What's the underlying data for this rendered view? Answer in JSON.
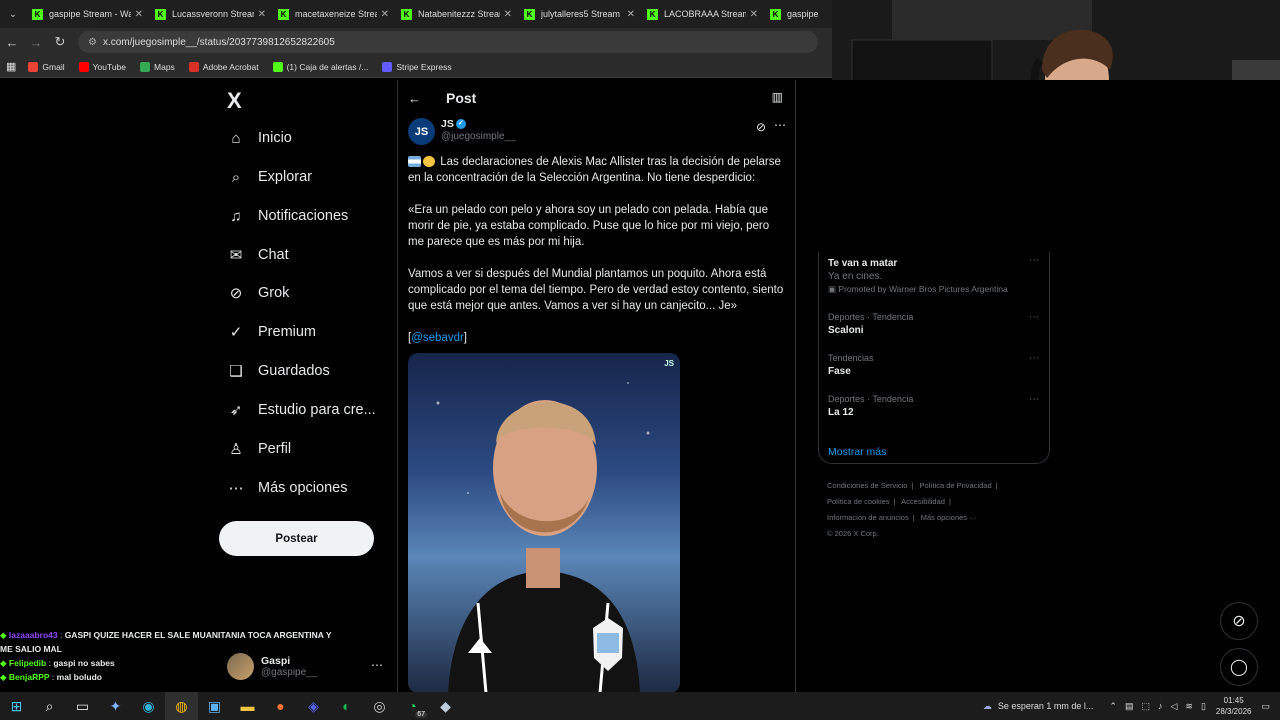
{
  "browser": {
    "tabs": [
      {
        "label": "gaspipe Stream - Wa"
      },
      {
        "label": "Lucassveronn Stream"
      },
      {
        "label": "macetaxeneize Strea"
      },
      {
        "label": "Natabenitezzz Stream"
      },
      {
        "label": "julytalleres5 Stream"
      },
      {
        "label": "LACOBRAAA Stream"
      },
      {
        "label": "gaspipe Strea"
      }
    ],
    "url": "x.com/juegosimple__/status/2037739812652822605",
    "bookmarks": [
      {
        "label": "Gmail",
        "color": "#ea4335"
      },
      {
        "label": "YouTube",
        "color": "#ff0000"
      },
      {
        "label": "Maps",
        "color": "#34a853"
      },
      {
        "label": "Adobe Acrobat",
        "color": "#d93025"
      },
      {
        "label": "(1) Caja de alertas /...",
        "color": "#53fc18"
      },
      {
        "label": "Stripe Express",
        "color": "#635bff"
      }
    ]
  },
  "nav": {
    "logo": "X",
    "items": [
      {
        "label": "Inicio",
        "icon": "⌂"
      },
      {
        "label": "Explorar",
        "icon": "⌕"
      },
      {
        "label": "Notificaciones",
        "icon": "♫"
      },
      {
        "label": "Chat",
        "icon": "✉"
      },
      {
        "label": "Grok",
        "icon": "⊘"
      },
      {
        "label": "Premium",
        "icon": "✓"
      },
      {
        "label": "Guardados",
        "icon": "❑"
      },
      {
        "label": "Estudio para cre...",
        "icon": "➶"
      },
      {
        "label": "Perfil",
        "icon": "♙"
      },
      {
        "label": "Más opciones",
        "icon": "⋯"
      }
    ],
    "post_button": "Postear",
    "account": {
      "name": "Gaspi",
      "handle": "@gaspipe__"
    }
  },
  "post": {
    "header_title": "Post",
    "author_initials": "JS",
    "author_name": "JS",
    "author_handle": "@juegosimple__",
    "paragraphs": [
      "Las declaraciones de Alexis Mac Allister tras la decisión de pelarse en la concentración de la Selección Argentina. No tiene desperdicio:",
      "«Era un pelado con pelo y ahora soy un pelado con pelada. Había que morir de pie, ya estaba complicado. Puse que lo hice por mi viejo, pero me parece que es más por mi hija.",
      "Vamos a ver si después del Mundial plantamos un poquito. Ahora está complicado por el tema del tiempo. Pero de verdad estoy contento, siento que está mejor que antes. Vamos a ver si hay un canjecito... Je»"
    ],
    "mention": "@sebavdr",
    "image_badge": "JS"
  },
  "trends": [
    {
      "meta": "",
      "title": "Te van a matar",
      "sub": "Ya en cines.",
      "promo": "Promoted by Warner Bros Pictures Argentina"
    },
    {
      "meta": "Deportes · Tendencia",
      "title": "Scaloni"
    },
    {
      "meta": "Tendencias",
      "title": "Fase"
    },
    {
      "meta": "Deportes · Tendencia",
      "title": "La 12"
    }
  ],
  "show_more": "Mostrar más",
  "footer": [
    "Condiciones de Servicio",
    "|",
    "Política de Privacidad",
    "|",
    "Política de cookies",
    "|",
    "Accesibilidad",
    "|",
    "Información de anuncios",
    "|",
    "Más opciones ···",
    "© 2026 X Corp."
  ],
  "chat": [
    {
      "user": "lazaaabro43",
      "color": "#9146ff",
      "text": "GASPI QUIZE HACER EL SALE MUANITANIA TOCA ARGENTINA Y ME SALIO MAL"
    },
    {
      "user": "Felipedib",
      "color": "#53fc18",
      "text": "gaspi no sabes"
    },
    {
      "user": "BenjaRPP",
      "color": "#53fc18",
      "text": "mal boludo"
    }
  ],
  "taskbar": {
    "weather": "Se esperan 1 mm de l...",
    "time": "01:45",
    "date": "28/3/2026",
    "badge": "67"
  }
}
